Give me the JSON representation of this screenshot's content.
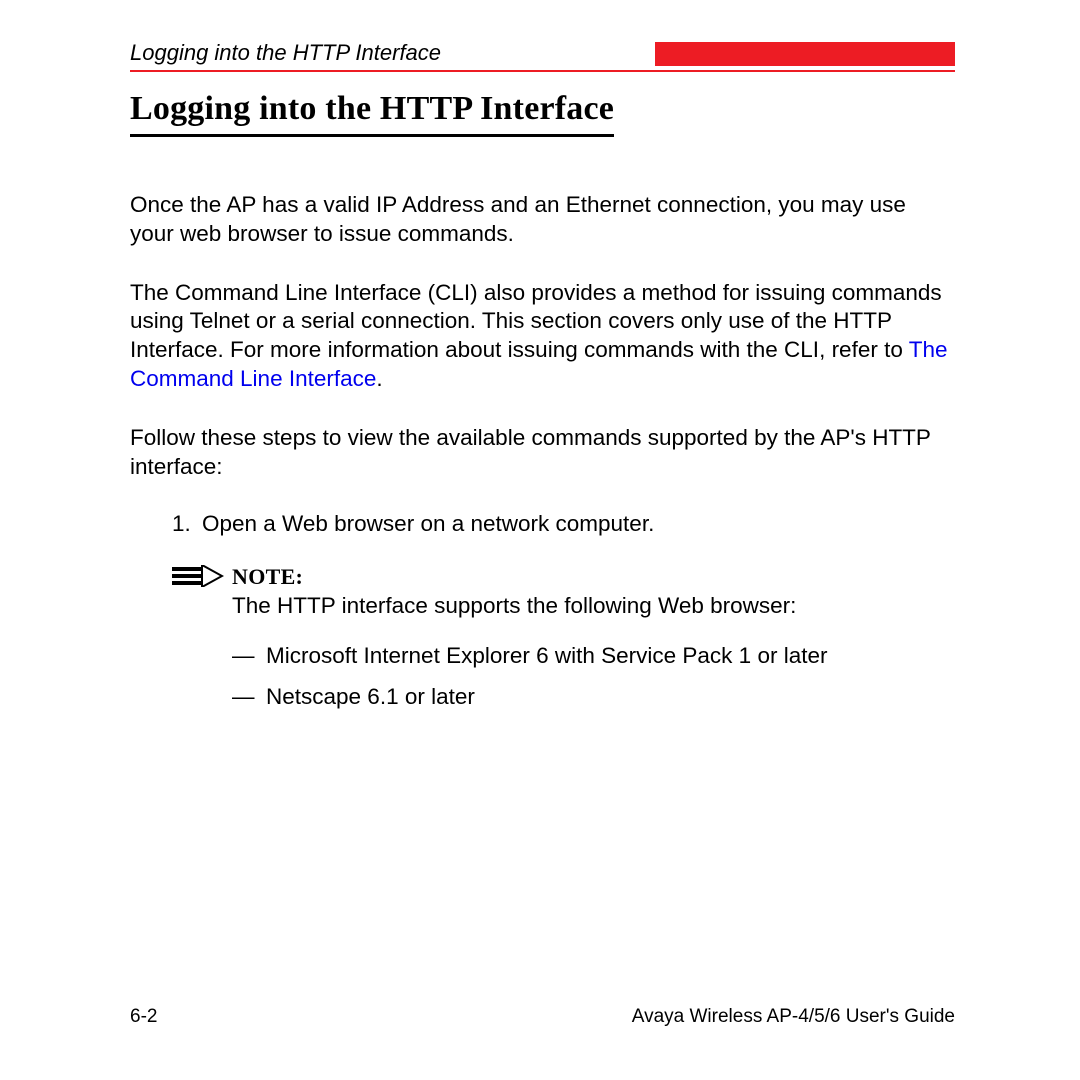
{
  "header": {
    "section_label": "Logging into the HTTP Interface"
  },
  "title": "Logging into the HTTP Interface",
  "paragraphs": {
    "p1": "Once the AP has a valid IP Address and an Ethernet connection, you may use your web browser to issue commands.",
    "p2a": "The Command Line Interface (CLI) also provides a method for issuing commands using Telnet or a serial connection. This section covers only use of the HTTP Interface. For more information about issuing commands with the CLI, refer to ",
    "p2_link": "The Command Line Interface",
    "p2b": ".",
    "p3": "Follow these steps to view the available commands supported by the AP's HTTP interface:"
  },
  "steps": {
    "s1_num": "1.",
    "s1_text": "Open a Web browser on a network computer."
  },
  "note": {
    "label": "NOTE:",
    "text": "The HTTP interface supports the following Web browser:",
    "items": {
      "i1": "Microsoft Internet Explorer 6 with Service Pack 1 or later",
      "i2": "Netscape 6.1 or later"
    },
    "dash": "—"
  },
  "footer": {
    "page": "6-2",
    "guide": "Avaya Wireless AP-4/5/6 User's Guide"
  }
}
